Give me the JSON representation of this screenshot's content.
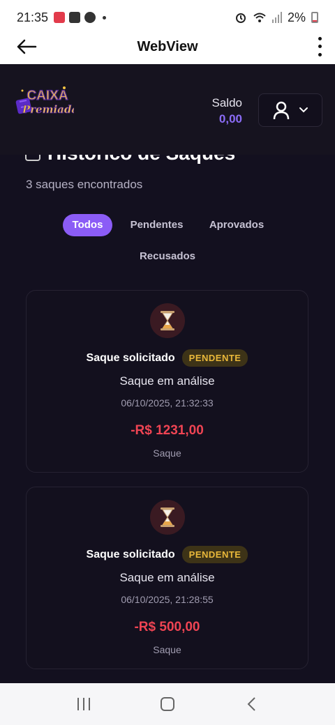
{
  "status_bar": {
    "time": "21:35",
    "battery": "2%",
    "icons": [
      "app-icon",
      "gallery-icon",
      "chat-icon",
      "alarm-icon",
      "wifi-icon",
      "signal-icon",
      "battery-icon"
    ]
  },
  "app_bar": {
    "title": "WebView"
  },
  "header": {
    "logo_line1": "CAIXA",
    "logo_line2": "Premiada",
    "balance_label": "Saldo",
    "balance_value": "0,00"
  },
  "page": {
    "title": "Histórico de Saques",
    "count_text": "3 saques encontrados"
  },
  "filters": [
    {
      "label": "Todos",
      "active": true
    },
    {
      "label": "Pendentes",
      "active": false
    },
    {
      "label": "Aprovados",
      "active": false
    },
    {
      "label": "Recusados",
      "active": false
    }
  ],
  "withdrawals": [
    {
      "title": "Saque solicitado",
      "status": "PENDENTE",
      "subtitle": "Saque em análise",
      "datetime": "06/10/2025, 21:32:33",
      "amount": "-R$ 1231,00",
      "type": "Saque"
    },
    {
      "title": "Saque solicitado",
      "status": "PENDENTE",
      "subtitle": "Saque em análise",
      "datetime": "06/10/2025, 21:28:55",
      "amount": "-R$ 500,00",
      "type": "Saque"
    }
  ],
  "colors": {
    "accent": "#8b5cf6",
    "negative_amount": "#ef4453",
    "pending_badge": "#e9b83a",
    "background": "#13101f"
  }
}
